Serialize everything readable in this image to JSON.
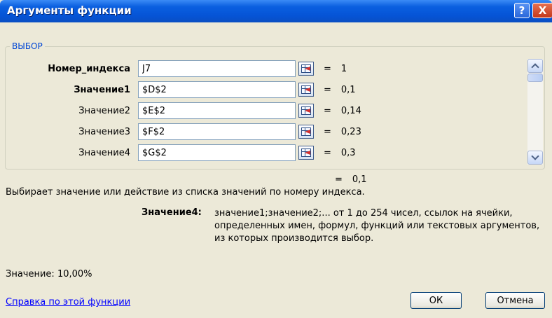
{
  "window": {
    "title": "Аргументы функции",
    "help_button": "?",
    "close_button": "X"
  },
  "group": {
    "label": "ВЫБОР"
  },
  "arguments": [
    {
      "label": "Номер_индекса",
      "value": "J7",
      "result": "1",
      "bold": true
    },
    {
      "label": "Значение1",
      "value": "$D$2",
      "result": "0,1",
      "bold": true
    },
    {
      "label": "Значение2",
      "value": "$E$2",
      "result": "0,14",
      "bold": false
    },
    {
      "label": "Значение3",
      "value": "$F$2",
      "result": "0,23",
      "bold": false
    },
    {
      "label": "Значение4",
      "value": "$G$2",
      "result": "0,3",
      "bold": false
    }
  ],
  "equals": "=",
  "function_result": "0,1",
  "description": "Выбирает значение или действие из списка значений по номеру индекса.",
  "argument_help": {
    "label": "Значение4:",
    "text": "значение1;значение2;... от 1 до 254 чисел, ссылок на ячейки, определенных имен, формул, функций или текстовых аргументов, из которых производится выбор."
  },
  "formula_result": "Значение:  10,00%",
  "help_link": "Справка по этой функции",
  "buttons": {
    "ok": "ОК",
    "cancel": "Отмена"
  },
  "icons": {
    "ref_button": "collapse-dialog-icon",
    "scroll_up": "chevron-up-icon",
    "scroll_down": "chevron-down-icon"
  }
}
